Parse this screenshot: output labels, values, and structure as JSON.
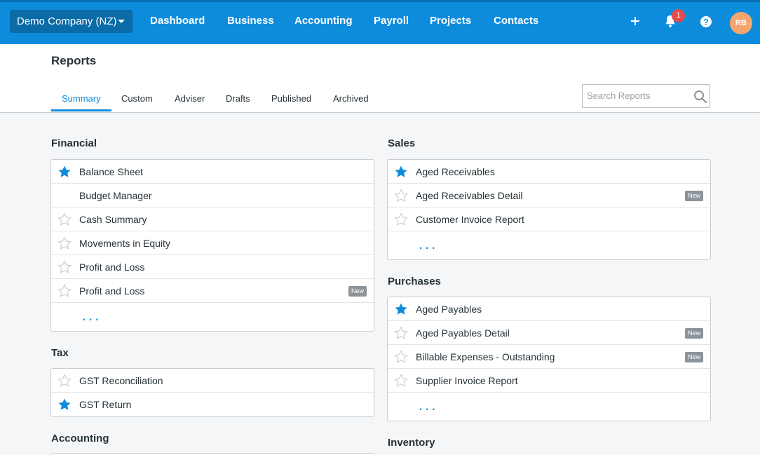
{
  "topbar": {
    "org_name": "Demo Company (NZ)",
    "nav": [
      "Dashboard",
      "Business",
      "Accounting",
      "Payroll",
      "Projects",
      "Contacts"
    ],
    "notification_count": "1",
    "avatar_initials": "RB",
    "accent_color": "#0d8cdc"
  },
  "page": {
    "title": "Reports",
    "tabs": [
      "Summary",
      "Custom",
      "Adviser",
      "Drafts",
      "Published",
      "Archived"
    ],
    "active_tab": "Summary",
    "search_placeholder": "Search Reports"
  },
  "sections": {
    "financial": {
      "title": "Financial",
      "items": [
        {
          "label": "Balance Sheet",
          "star": "filled"
        },
        {
          "label": "Budget Manager",
          "star": "none"
        },
        {
          "label": "Cash Summary",
          "star": "empty"
        },
        {
          "label": "Movements in Equity",
          "star": "empty"
        },
        {
          "label": "Profit and Loss",
          "star": "empty"
        },
        {
          "label": "Profit and Loss",
          "star": "empty",
          "badge": "New"
        }
      ],
      "more": "..."
    },
    "tax": {
      "title": "Tax",
      "items": [
        {
          "label": "GST Reconciliation",
          "star": "empty"
        },
        {
          "label": "GST Return",
          "star": "filled"
        }
      ]
    },
    "accounting": {
      "title": "Accounting"
    },
    "sales": {
      "title": "Sales",
      "items": [
        {
          "label": "Aged Receivables",
          "star": "filled"
        },
        {
          "label": "Aged Receivables Detail",
          "star": "empty",
          "badge": "New"
        },
        {
          "label": "Customer Invoice Report",
          "star": "empty"
        }
      ],
      "more": "..."
    },
    "purchases": {
      "title": "Purchases",
      "items": [
        {
          "label": "Aged Payables",
          "star": "filled"
        },
        {
          "label": "Aged Payables Detail",
          "star": "empty",
          "badge": "New"
        },
        {
          "label": "Billable Expenses - Outstanding",
          "star": "empty",
          "badge": "New"
        },
        {
          "label": "Supplier Invoice Report",
          "star": "empty"
        }
      ],
      "more": "..."
    },
    "inventory": {
      "title": "Inventory"
    }
  }
}
